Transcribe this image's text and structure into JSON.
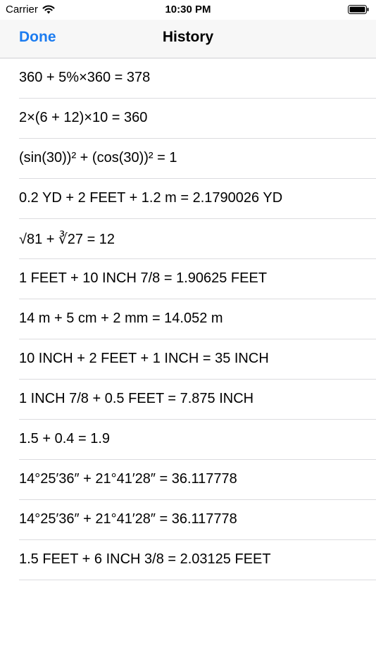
{
  "status_bar": {
    "carrier": "Carrier",
    "time": "10:30 PM",
    "icons": [
      "wifi-icon",
      "battery-icon"
    ]
  },
  "nav": {
    "done_label": "Done",
    "title": "History",
    "accent_color": "#1c7cf0"
  },
  "history": {
    "items": [
      "360 + 5%×360 = 378",
      "2×(6 + 12)×10 = 360",
      "(sin(30))² + (cos(30))² = 1",
      "0.2 YD + 2 FEET + 1.2 m = 2.1790026 YD",
      "√81 + ∛27 = 12",
      "1 FEET + 10 INCH 7/8 = 1.90625 FEET",
      "14 m + 5 cm + 2 mm = 14.052 m",
      "10 INCH + 2 FEET + 1 INCH = 35 INCH",
      "1 INCH 7/8 + 0.5 FEET = 7.875 INCH",
      "1.5 + 0.4 = 1.9",
      "14°25′36″ + 21°41′28″ = 36.117778",
      "14°25′36″ + 21°41′28″ = 36.117778",
      "1.5 FEET + 6 INCH 3/8 = 2.03125 FEET"
    ]
  }
}
